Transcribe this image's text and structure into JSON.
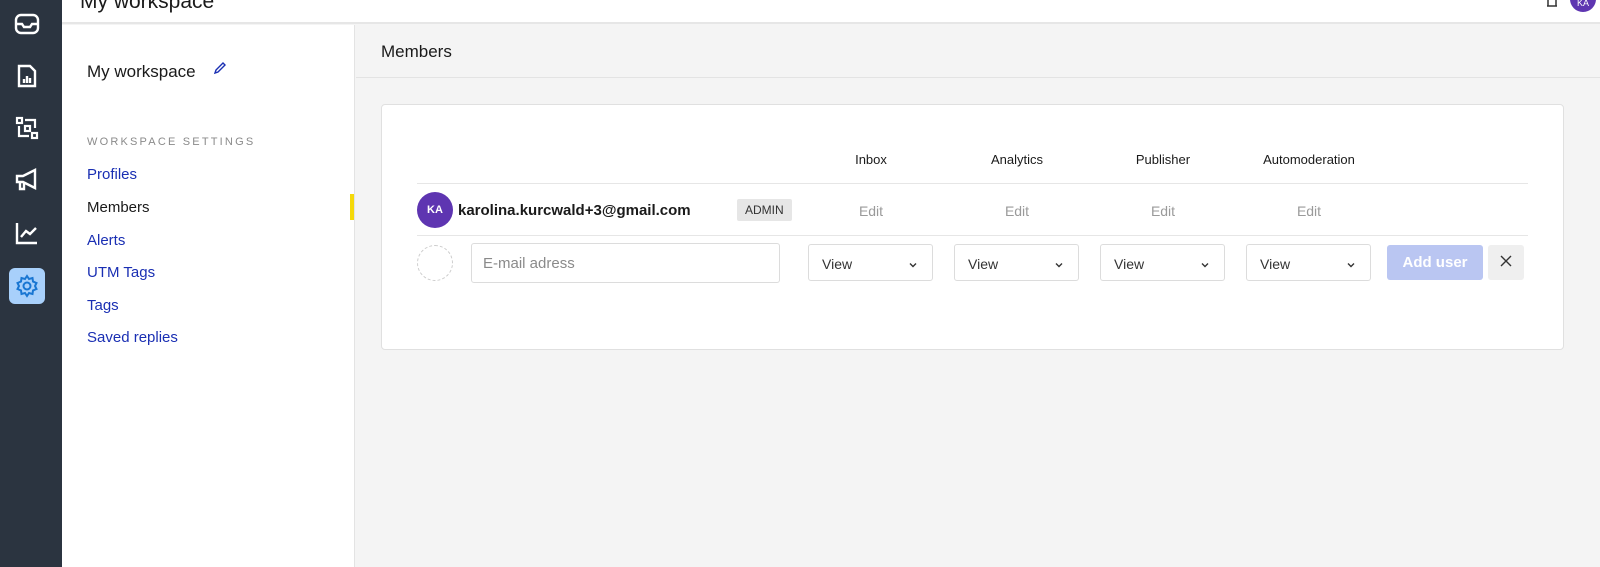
{
  "topbar": {
    "workspace": "My workspace",
    "avatar": "KA"
  },
  "rail": {
    "items": [
      "inbox-icon",
      "report-icon",
      "flow-icon",
      "megaphone-icon",
      "chart-icon",
      "gear-icon"
    ],
    "active": "gear-icon"
  },
  "sidebar": {
    "title": "My workspace",
    "section": "WORKSPACE SETTINGS",
    "items": [
      {
        "label": "Profiles"
      },
      {
        "label": "Members",
        "current": true
      },
      {
        "label": "Alerts"
      },
      {
        "label": "UTM Tags"
      },
      {
        "label": "Tags"
      },
      {
        "label": "Saved replies"
      }
    ]
  },
  "main": {
    "title": "Members",
    "columns": [
      "Inbox",
      "Analytics",
      "Publisher",
      "Automoderation"
    ],
    "member": {
      "initials": "KA",
      "email": "karolina.kurcwald+3@gmail.com",
      "role": "ADMIN",
      "permissions": [
        "Edit",
        "Edit",
        "Edit",
        "Edit"
      ]
    },
    "new_user": {
      "email_placeholder": "E-mail adress",
      "email_value": "",
      "permissions": [
        "View",
        "View",
        "View",
        "View"
      ],
      "add_label": "Add user"
    }
  },
  "colors": {
    "accent": "#1a2fb3",
    "avatar": "#5e35b1",
    "rail": "#2b3440",
    "add_button": "#bac6f2",
    "active_marker": "#f5d90a"
  }
}
